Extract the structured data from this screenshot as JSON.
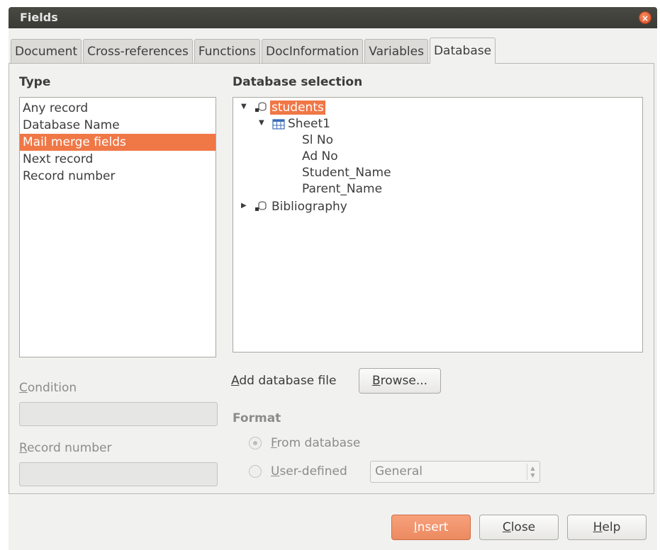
{
  "window": {
    "title": "Fields",
    "close_glyph": "×"
  },
  "tabs": [
    {
      "label": "Document"
    },
    {
      "label": "Cross-references"
    },
    {
      "label": "Functions"
    },
    {
      "label": "DocInformation"
    },
    {
      "label": "Variables"
    },
    {
      "label": "Database",
      "active": true
    }
  ],
  "type_section": {
    "heading": "Type",
    "items": [
      "Any record",
      "Database Name",
      "Mail merge fields",
      "Next record",
      "Record number"
    ],
    "selected": "Mail merge fields"
  },
  "db_selection": {
    "heading": "Database selection",
    "tree": {
      "students": "students",
      "sheet1": "Sheet1",
      "fields": [
        "Sl No",
        "Ad No",
        "Student_Name",
        "Parent_Name"
      ],
      "bibliography": "Bibliography"
    }
  },
  "condition": {
    "label": "Condition",
    "value": ""
  },
  "record_number": {
    "label": "Record number",
    "value": ""
  },
  "add_db": {
    "label": "Add database file",
    "browse_label": "Browse..."
  },
  "format": {
    "heading": "Format",
    "from_database": "From database",
    "user_defined": "User-defined",
    "select_value": "General",
    "selected_option": "From database"
  },
  "buttons": {
    "insert": "Insert",
    "close": "Close",
    "help": "Help"
  },
  "icons": {
    "database": "database-icon",
    "table": "table-icon",
    "expand": "triangle-down-icon",
    "collapse": "triangle-right-icon"
  },
  "colors": {
    "accent": "#f07746",
    "titlebar": "#3f3f3b"
  }
}
